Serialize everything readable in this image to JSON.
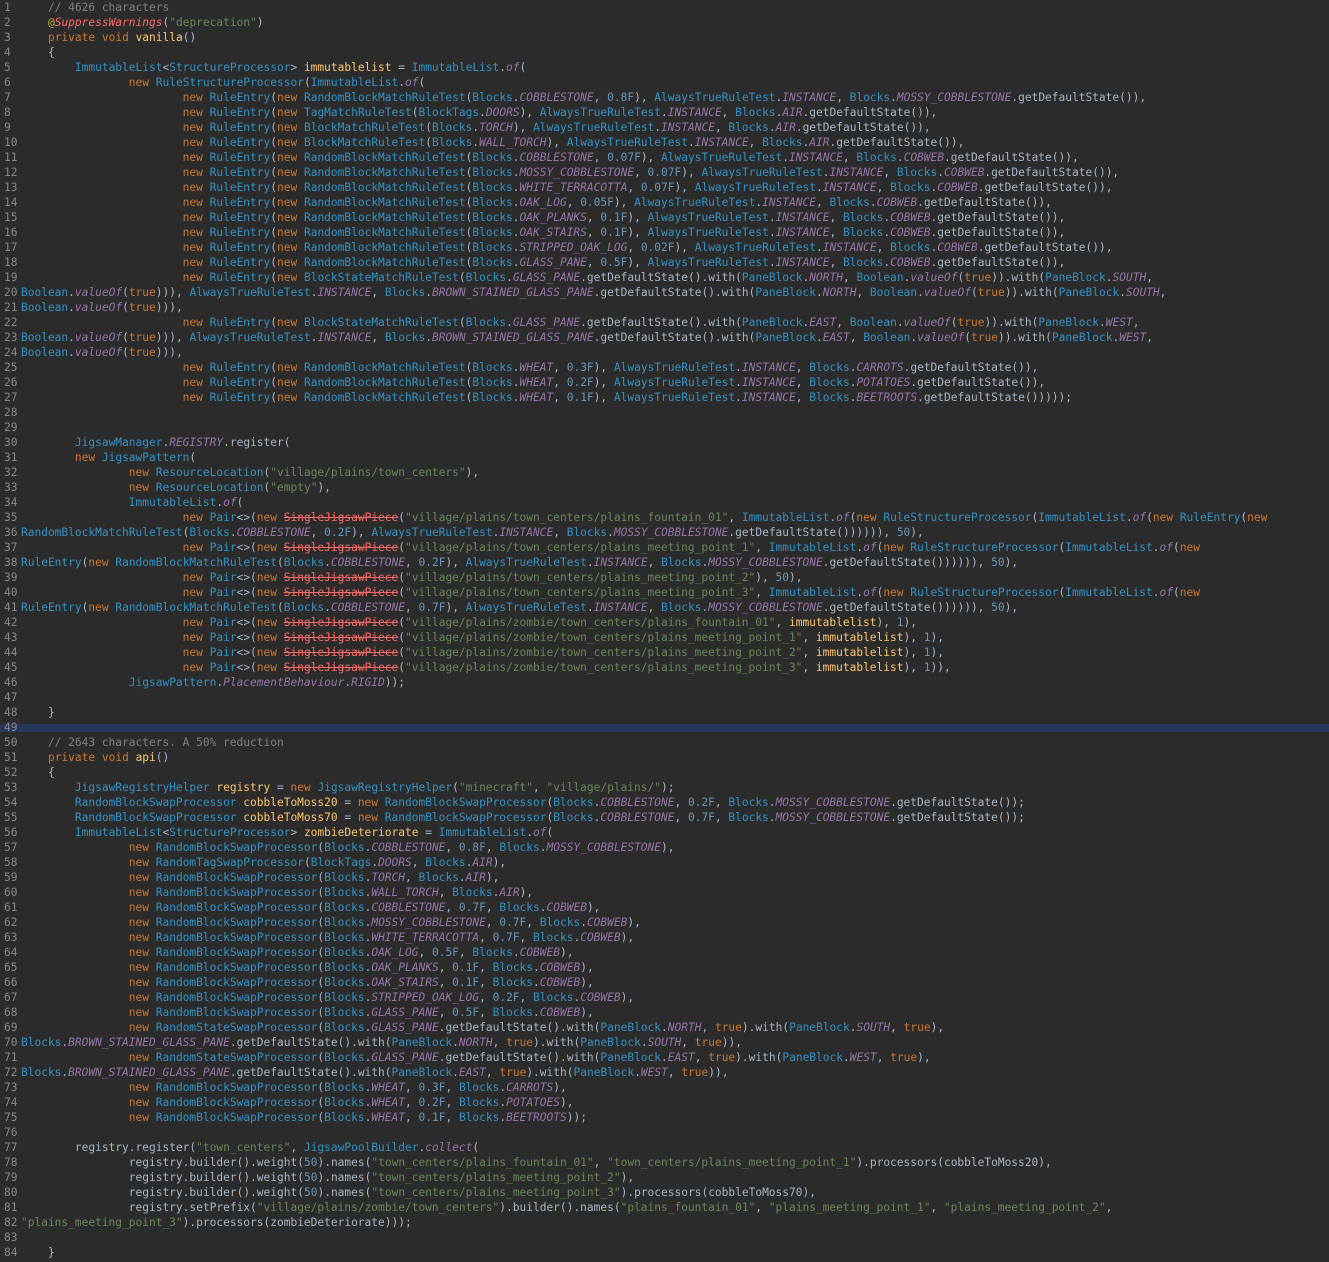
{
  "editor": {
    "lines": [
      {
        "n": "1",
        "t": "    // 4626 characters"
      },
      {
        "n": "2",
        "t": "    @SuppressWarnings(\"deprecation\")"
      },
      {
        "n": "3",
        "t": "    private void vanilla()"
      },
      {
        "n": "4",
        "t": "    {"
      },
      {
        "n": "5",
        "t": "        ImmutableList<StructureProcessor> immutablelist = ImmutableList.of("
      },
      {
        "n": "6",
        "t": "                new RuleStructureProcessor(ImmutableList.of("
      },
      {
        "n": "7",
        "t": "                        new RuleEntry(new RandomBlockMatchRuleTest(Blocks.COBBLESTONE, 0.8F), AlwaysTrueRuleTest.INSTANCE, Blocks.MOSSY_COBBLESTONE.getDefaultState()),"
      },
      {
        "n": "8",
        "t": "                        new RuleEntry(new TagMatchRuleTest(BlockTags.DOORS), AlwaysTrueRuleTest.INSTANCE, Blocks.AIR.getDefaultState()),"
      },
      {
        "n": "9",
        "t": "                        new RuleEntry(new BlockMatchRuleTest(Blocks.TORCH), AlwaysTrueRuleTest.INSTANCE, Blocks.AIR.getDefaultState()),"
      },
      {
        "n": "10",
        "t": "                        new RuleEntry(new BlockMatchRuleTest(Blocks.WALL_TORCH), AlwaysTrueRuleTest.INSTANCE, Blocks.AIR.getDefaultState()),"
      },
      {
        "n": "11",
        "t": "                        new RuleEntry(new RandomBlockMatchRuleTest(Blocks.COBBLESTONE, 0.07F), AlwaysTrueRuleTest.INSTANCE, Blocks.COBWEB.getDefaultState()),"
      },
      {
        "n": "12",
        "t": "                        new RuleEntry(new RandomBlockMatchRuleTest(Blocks.MOSSY_COBBLESTONE, 0.07F), AlwaysTrueRuleTest.INSTANCE, Blocks.COBWEB.getDefaultState()),"
      },
      {
        "n": "13",
        "t": "                        new RuleEntry(new RandomBlockMatchRuleTest(Blocks.WHITE_TERRACOTTA, 0.07F), AlwaysTrueRuleTest.INSTANCE, Blocks.COBWEB.getDefaultState()),"
      },
      {
        "n": "14",
        "t": "                        new RuleEntry(new RandomBlockMatchRuleTest(Blocks.OAK_LOG, 0.05F), AlwaysTrueRuleTest.INSTANCE, Blocks.COBWEB.getDefaultState()),"
      },
      {
        "n": "15",
        "t": "                        new RuleEntry(new RandomBlockMatchRuleTest(Blocks.OAK_PLANKS, 0.1F), AlwaysTrueRuleTest.INSTANCE, Blocks.COBWEB.getDefaultState()),"
      },
      {
        "n": "16",
        "t": "                        new RuleEntry(new RandomBlockMatchRuleTest(Blocks.OAK_STAIRS, 0.1F), AlwaysTrueRuleTest.INSTANCE, Blocks.COBWEB.getDefaultState()),"
      },
      {
        "n": "17",
        "t": "                        new RuleEntry(new RandomBlockMatchRuleTest(Blocks.STRIPPED_OAK_LOG, 0.02F), AlwaysTrueRuleTest.INSTANCE, Blocks.COBWEB.getDefaultState()),"
      },
      {
        "n": "18",
        "t": "                        new RuleEntry(new RandomBlockMatchRuleTest(Blocks.GLASS_PANE, 0.5F), AlwaysTrueRuleTest.INSTANCE, Blocks.COBWEB.getDefaultState()),"
      },
      {
        "n": "19",
        "t": "                        new RuleEntry(new BlockStateMatchRuleTest(Blocks.GLASS_PANE.getDefaultState().with(PaneBlock.NORTH, Boolean.valueOf(true)).with(PaneBlock.SOUTH,"
      },
      {
        "n": "20",
        "t": "Boolean.valueOf(true))), AlwaysTrueRuleTest.INSTANCE, Blocks.BROWN_STAINED_GLASS_PANE.getDefaultState().with(PaneBlock.NORTH, Boolean.valueOf(true)).with(PaneBlock.SOUTH,"
      },
      {
        "n": "21",
        "t": "Boolean.valueOf(true))),"
      },
      {
        "n": "22",
        "t": "                        new RuleEntry(new BlockStateMatchRuleTest(Blocks.GLASS_PANE.getDefaultState().with(PaneBlock.EAST, Boolean.valueOf(true)).with(PaneBlock.WEST,"
      },
      {
        "n": "23",
        "t": "Boolean.valueOf(true))), AlwaysTrueRuleTest.INSTANCE, Blocks.BROWN_STAINED_GLASS_PANE.getDefaultState().with(PaneBlock.EAST, Boolean.valueOf(true)).with(PaneBlock.WEST,"
      },
      {
        "n": "24",
        "t": "Boolean.valueOf(true))),"
      },
      {
        "n": "25",
        "t": "                        new RuleEntry(new RandomBlockMatchRuleTest(Blocks.WHEAT, 0.3F), AlwaysTrueRuleTest.INSTANCE, Blocks.CARROTS.getDefaultState()),"
      },
      {
        "n": "26",
        "t": "                        new RuleEntry(new RandomBlockMatchRuleTest(Blocks.WHEAT, 0.2F), AlwaysTrueRuleTest.INSTANCE, Blocks.POTATOES.getDefaultState()),"
      },
      {
        "n": "27",
        "t": "                        new RuleEntry(new RandomBlockMatchRuleTest(Blocks.WHEAT, 0.1F), AlwaysTrueRuleTest.INSTANCE, Blocks.BEETROOTS.getDefaultState()))));"
      },
      {
        "n": "28",
        "t": ""
      },
      {
        "n": "29",
        "t": ""
      },
      {
        "n": "30",
        "t": "        JigsawManager.REGISTRY.register("
      },
      {
        "n": "31",
        "t": "        new JigsawPattern("
      },
      {
        "n": "32",
        "t": "                new ResourceLocation(\"village/plains/town_centers\"),"
      },
      {
        "n": "33",
        "t": "                new ResourceLocation(\"empty\"),"
      },
      {
        "n": "34",
        "t": "                ImmutableList.of("
      },
      {
        "n": "35",
        "t": "                        new Pair<>(new SingleJigsawPiece(\"village/plains/town_centers/plains_fountain_01\", ImmutableList.of(new RuleStructureProcessor(ImmutableList.of(new RuleEntry(new"
      },
      {
        "n": "36",
        "t": "RandomBlockMatchRuleTest(Blocks.COBBLESTONE, 0.2F), AlwaysTrueRuleTest.INSTANCE, Blocks.MOSSY_COBBLESTONE.getDefaultState()))))), 50),"
      },
      {
        "n": "37",
        "t": "                        new Pair<>(new SingleJigsawPiece(\"village/plains/town_centers/plains_meeting_point_1\", ImmutableList.of(new RuleStructureProcessor(ImmutableList.of(new"
      },
      {
        "n": "38",
        "t": "RuleEntry(new RandomBlockMatchRuleTest(Blocks.COBBLESTONE, 0.2F), AlwaysTrueRuleTest.INSTANCE, Blocks.MOSSY_COBBLESTONE.getDefaultState()))))), 50),"
      },
      {
        "n": "39",
        "t": "                        new Pair<>(new SingleJigsawPiece(\"village/plains/town_centers/plains_meeting_point_2\"), 50),"
      },
      {
        "n": "40",
        "t": "                        new Pair<>(new SingleJigsawPiece(\"village/plains/town_centers/plains_meeting_point_3\", ImmutableList.of(new RuleStructureProcessor(ImmutableList.of(new"
      },
      {
        "n": "41",
        "t": "RuleEntry(new RandomBlockMatchRuleTest(Blocks.COBBLESTONE, 0.7F), AlwaysTrueRuleTest.INSTANCE, Blocks.MOSSY_COBBLESTONE.getDefaultState()))))), 50),"
      },
      {
        "n": "42",
        "t": "                        new Pair<>(new SingleJigsawPiece(\"village/plains/zombie/town_centers/plains_fountain_01\", immutablelist), 1),"
      },
      {
        "n": "43",
        "t": "                        new Pair<>(new SingleJigsawPiece(\"village/plains/zombie/town_centers/plains_meeting_point_1\", immutablelist), 1),"
      },
      {
        "n": "44",
        "t": "                        new Pair<>(new SingleJigsawPiece(\"village/plains/zombie/town_centers/plains_meeting_point_2\", immutablelist), 1),"
      },
      {
        "n": "45",
        "t": "                        new Pair<>(new SingleJigsawPiece(\"village/plains/zombie/town_centers/plains_meeting_point_3\", immutablelist), 1)),"
      },
      {
        "n": "46",
        "t": "                JigsawPattern.PlacementBehaviour.RIGID));"
      },
      {
        "n": "47",
        "t": ""
      },
      {
        "n": "48",
        "t": "    }"
      },
      {
        "n": "49",
        "t": ""
      },
      {
        "n": "50",
        "t": "    // 2643 characters. A 50% reduction"
      },
      {
        "n": "51",
        "t": "    private void api()"
      },
      {
        "n": "52",
        "t": "    {"
      },
      {
        "n": "53",
        "t": "        JigsawRegistryHelper registry = new JigsawRegistryHelper(\"minecraft\", \"village/plains/\");"
      },
      {
        "n": "54",
        "t": "        RandomBlockSwapProcessor cobbleToMoss20 = new RandomBlockSwapProcessor(Blocks.COBBLESTONE, 0.2F, Blocks.MOSSY_COBBLESTONE.getDefaultState());"
      },
      {
        "n": "55",
        "t": "        RandomBlockSwapProcessor cobbleToMoss70 = new RandomBlockSwapProcessor(Blocks.COBBLESTONE, 0.7F, Blocks.MOSSY_COBBLESTONE.getDefaultState());"
      },
      {
        "n": "56",
        "t": "        ImmutableList<StructureProcessor> zombieDeteriorate = ImmutableList.of("
      },
      {
        "n": "57",
        "t": "                new RandomBlockSwapProcessor(Blocks.COBBLESTONE, 0.8F, Blocks.MOSSY_COBBLESTONE),"
      },
      {
        "n": "58",
        "t": "                new RandomTagSwapProcessor(BlockTags.DOORS, Blocks.AIR),"
      },
      {
        "n": "59",
        "t": "                new RandomBlockSwapProcessor(Blocks.TORCH, Blocks.AIR),"
      },
      {
        "n": "60",
        "t": "                new RandomBlockSwapProcessor(Blocks.WALL_TORCH, Blocks.AIR),"
      },
      {
        "n": "61",
        "t": "                new RandomBlockSwapProcessor(Blocks.COBBLESTONE, 0.7F, Blocks.COBWEB),"
      },
      {
        "n": "62",
        "t": "                new RandomBlockSwapProcessor(Blocks.MOSSY_COBBLESTONE, 0.7F, Blocks.COBWEB),"
      },
      {
        "n": "63",
        "t": "                new RandomBlockSwapProcessor(Blocks.WHITE_TERRACOTTA, 0.7F, Blocks.COBWEB),"
      },
      {
        "n": "64",
        "t": "                new RandomBlockSwapProcessor(Blocks.OAK_LOG, 0.5F, Blocks.COBWEB),"
      },
      {
        "n": "65",
        "t": "                new RandomBlockSwapProcessor(Blocks.OAK_PLANKS, 0.1F, Blocks.COBWEB),"
      },
      {
        "n": "66",
        "t": "                new RandomBlockSwapProcessor(Blocks.OAK_STAIRS, 0.1F, Blocks.COBWEB),"
      },
      {
        "n": "67",
        "t": "                new RandomBlockSwapProcessor(Blocks.STRIPPED_OAK_LOG, 0.2F, Blocks.COBWEB),"
      },
      {
        "n": "68",
        "t": "                new RandomBlockSwapProcessor(Blocks.GLASS_PANE, 0.5F, Blocks.COBWEB),"
      },
      {
        "n": "69",
        "t": "                new RandomStateSwapProcessor(Blocks.GLASS_PANE.getDefaultState().with(PaneBlock.NORTH, true).with(PaneBlock.SOUTH, true),"
      },
      {
        "n": "70",
        "t": "Blocks.BROWN_STAINED_GLASS_PANE.getDefaultState().with(PaneBlock.NORTH, true).with(PaneBlock.SOUTH, true)),"
      },
      {
        "n": "71",
        "t": "                new RandomStateSwapProcessor(Blocks.GLASS_PANE.getDefaultState().with(PaneBlock.EAST, true).with(PaneBlock.WEST, true),"
      },
      {
        "n": "72",
        "t": "Blocks.BROWN_STAINED_GLASS_PANE.getDefaultState().with(PaneBlock.EAST, true).with(PaneBlock.WEST, true)),"
      },
      {
        "n": "73",
        "t": "                new RandomBlockSwapProcessor(Blocks.WHEAT, 0.3F, Blocks.CARROTS),"
      },
      {
        "n": "74",
        "t": "                new RandomBlockSwapProcessor(Blocks.WHEAT, 0.2F, Blocks.POTATOES),"
      },
      {
        "n": "75",
        "t": "                new RandomBlockSwapProcessor(Blocks.WHEAT, 0.1F, Blocks.BEETROOTS));"
      },
      {
        "n": "76",
        "t": ""
      },
      {
        "n": "77",
        "t": "        registry.register(\"town_centers\", JigsawPoolBuilder.collect("
      },
      {
        "n": "78",
        "t": "                registry.builder().weight(50).names(\"town_centers/plains_fountain_01\", \"town_centers/plains_meeting_point_1\").processors(cobbleToMoss20),"
      },
      {
        "n": "79",
        "t": "                registry.builder().weight(50).names(\"town_centers/plains_meeting_point_2\"),"
      },
      {
        "n": "80",
        "t": "                registry.builder().weight(50).names(\"town_centers/plains_meeting_point_3\").processors(cobbleToMoss70),"
      },
      {
        "n": "81",
        "t": "                registry.setPrefix(\"village/plains/zombie/town_centers\").builder().names(\"plains_fountain_01\", \"plains_meeting_point_1\", \"plains_meeting_point_2\","
      },
      {
        "n": "82",
        "t": "\"plains_meeting_point_3\").processors(zombieDeteriorate)));"
      },
      {
        "n": "83",
        "t": ""
      },
      {
        "n": "84",
        "t": "    }"
      }
    ]
  },
  "colors": {
    "background": "#2b2b2b",
    "keyword": "#cc7832",
    "string": "#6a8759",
    "comment": "#808080",
    "static_field": "#9876aa",
    "method_decl": "#ffc66d",
    "type": "#6897bb",
    "deprecated": "#ff6b68",
    "separator_highlight": "#214283"
  }
}
